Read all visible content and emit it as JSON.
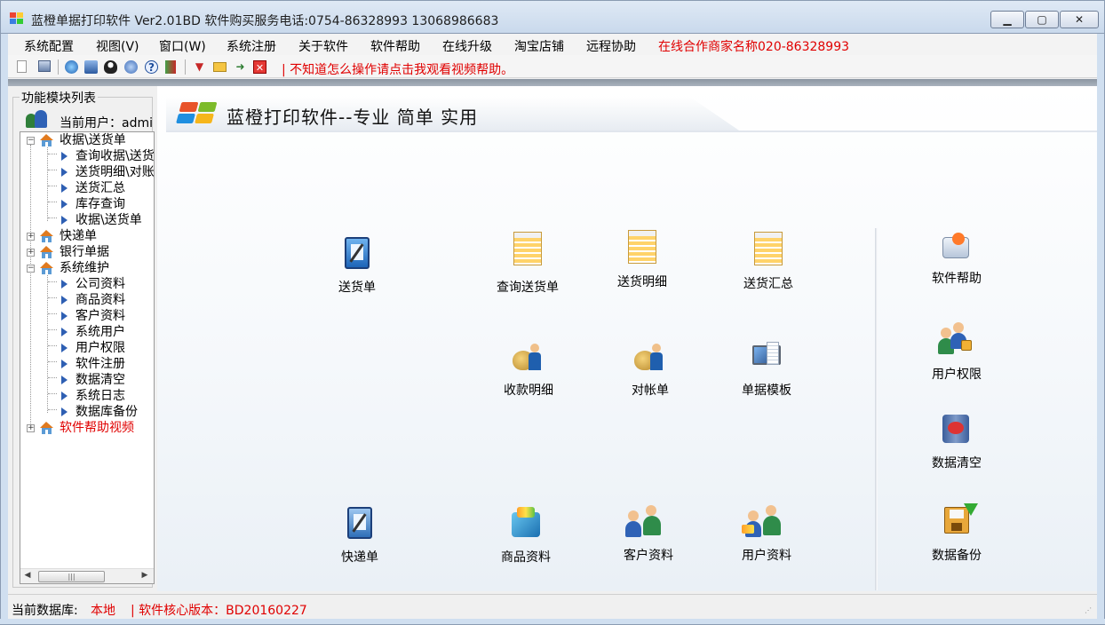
{
  "window": {
    "title": "蓝橙单据打印软件 Ver2.01BD  软件购买服务电话:0754-86328993 13068986683",
    "minimize": "▁",
    "maximize": "▢",
    "close": "✕"
  },
  "menu": [
    {
      "label": "系统配置"
    },
    {
      "label": "视图(V)"
    },
    {
      "label": "窗口(W)"
    },
    {
      "label": "系统注册"
    },
    {
      "label": "关于软件"
    },
    {
      "label": "软件帮助"
    },
    {
      "label": "在线升级"
    },
    {
      "label": "淘宝店铺"
    },
    {
      "label": "远程协助"
    },
    {
      "label": "在线合作商家名称020-86328993"
    }
  ],
  "toolbar": {
    "message": "| 不知道怎么操作请点击我观看视频帮助。"
  },
  "panel": {
    "title": "功能模块列表",
    "current_user_label": "当前用户：admin"
  },
  "tree": [
    {
      "label": "收据\\送货单",
      "expanded": true,
      "children": [
        "查询收据\\送货单",
        "送货明细\\对账",
        "送货汇总",
        "库存查询",
        "收据\\送货单"
      ]
    },
    {
      "label": "快递单",
      "expanded": false
    },
    {
      "label": "银行单据",
      "expanded": false
    },
    {
      "label": "系统维护",
      "expanded": true,
      "children": [
        "公司资料",
        "商品资料",
        "客户资料",
        "系统用户",
        "用户权限",
        "软件注册",
        "数据清空",
        "系统日志",
        "数据库备份"
      ]
    },
    {
      "label": "软件帮助视频",
      "expanded": false,
      "color": "#e00000"
    }
  ],
  "banner": {
    "text": "蓝橙打印软件--专业 简单 实用"
  },
  "tiles": {
    "songhuodan": "送货单",
    "chaxun": "查询送货单",
    "mingxi": "送货明细",
    "huizong": "送货汇总",
    "shoukuan": "收款明细",
    "duizhang": "对帐单",
    "moban": "单据模板",
    "kuaidi": "快递单",
    "shangpin": "商品资料",
    "kehu": "客户资料",
    "yonghu": "用户资料",
    "bangzhu": "软件帮助",
    "quanxian": "用户权限",
    "qingkong": "数据清空",
    "beifen": "数据备份"
  },
  "status": {
    "db_label": "当前数据库:",
    "db_value": "本地",
    "version": "| 软件核心版本：BD20160227"
  },
  "colors": {
    "accent_red": "#e00000",
    "titlebar": "#c9d9ec",
    "tree_arrow": "#2e5fb3"
  }
}
